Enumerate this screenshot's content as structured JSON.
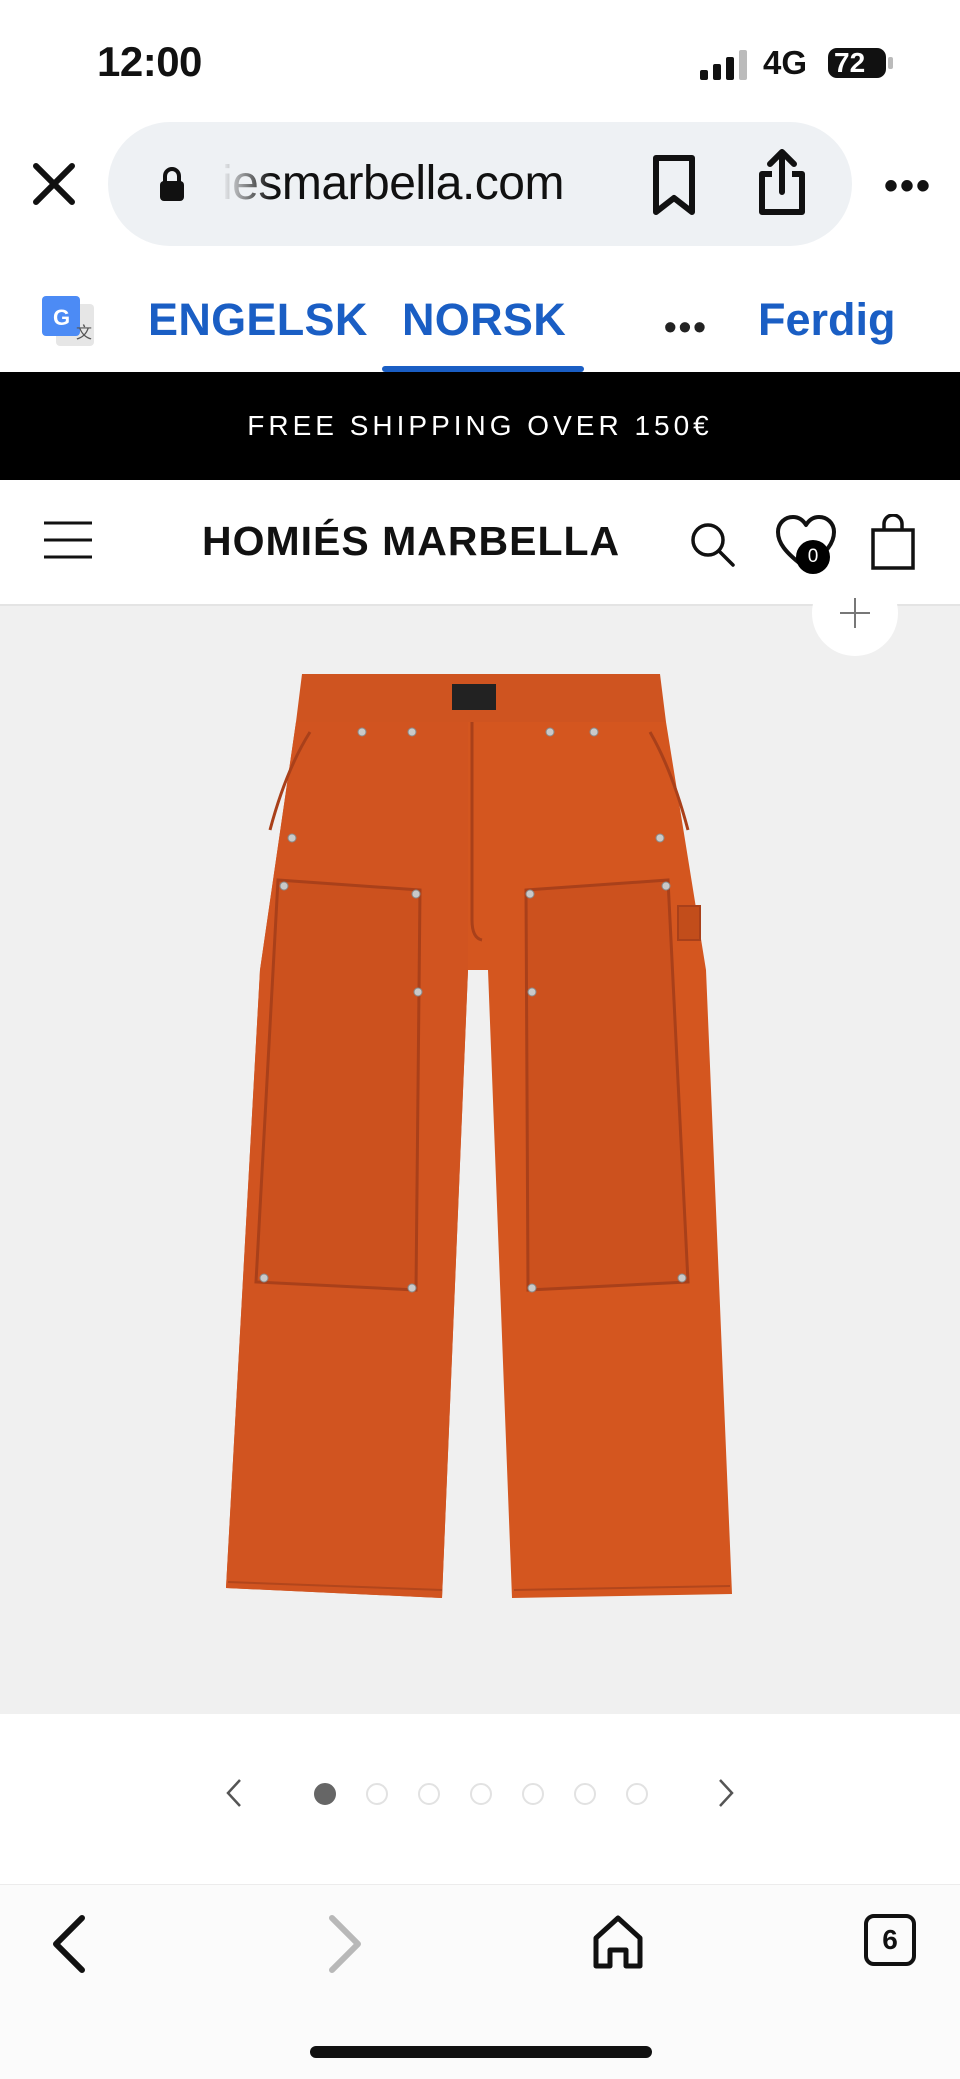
{
  "status_bar": {
    "time": "12:00",
    "network": "4G",
    "battery": "72",
    "icons": [
      "signal-icon",
      "battery-icon"
    ]
  },
  "browser": {
    "url": "iesmarbella.com",
    "icons": [
      "close-icon",
      "lock-icon",
      "bookmark-icon",
      "share-icon",
      "more-icon"
    ]
  },
  "translate_bar": {
    "languages": [
      "ENGELSK",
      "NORSK"
    ],
    "active_language": "NORSK",
    "more": "•••",
    "done_label": "Ferdig",
    "accent": "#1a5ec4"
  },
  "promo": {
    "text": "FREE SHIPPING OVER 150€"
  },
  "site_header": {
    "logo": "HOMIÉS MARBELLA",
    "wishlist_count": "0",
    "icons": [
      "menu-icon",
      "search-icon",
      "heart-icon",
      "bag-icon"
    ]
  },
  "product": {
    "image": "orange-carpenter-pants",
    "image_color": "#d4561f",
    "zoom_icon": "plus-icon"
  },
  "carousel": {
    "total": 7,
    "active_index": 0,
    "icons": [
      "chevron-left-icon",
      "chevron-right-icon"
    ]
  },
  "bottom_bar": {
    "tab_count": "6",
    "icons": [
      "back-icon",
      "forward-icon",
      "home-icon",
      "tabs-icon"
    ]
  }
}
